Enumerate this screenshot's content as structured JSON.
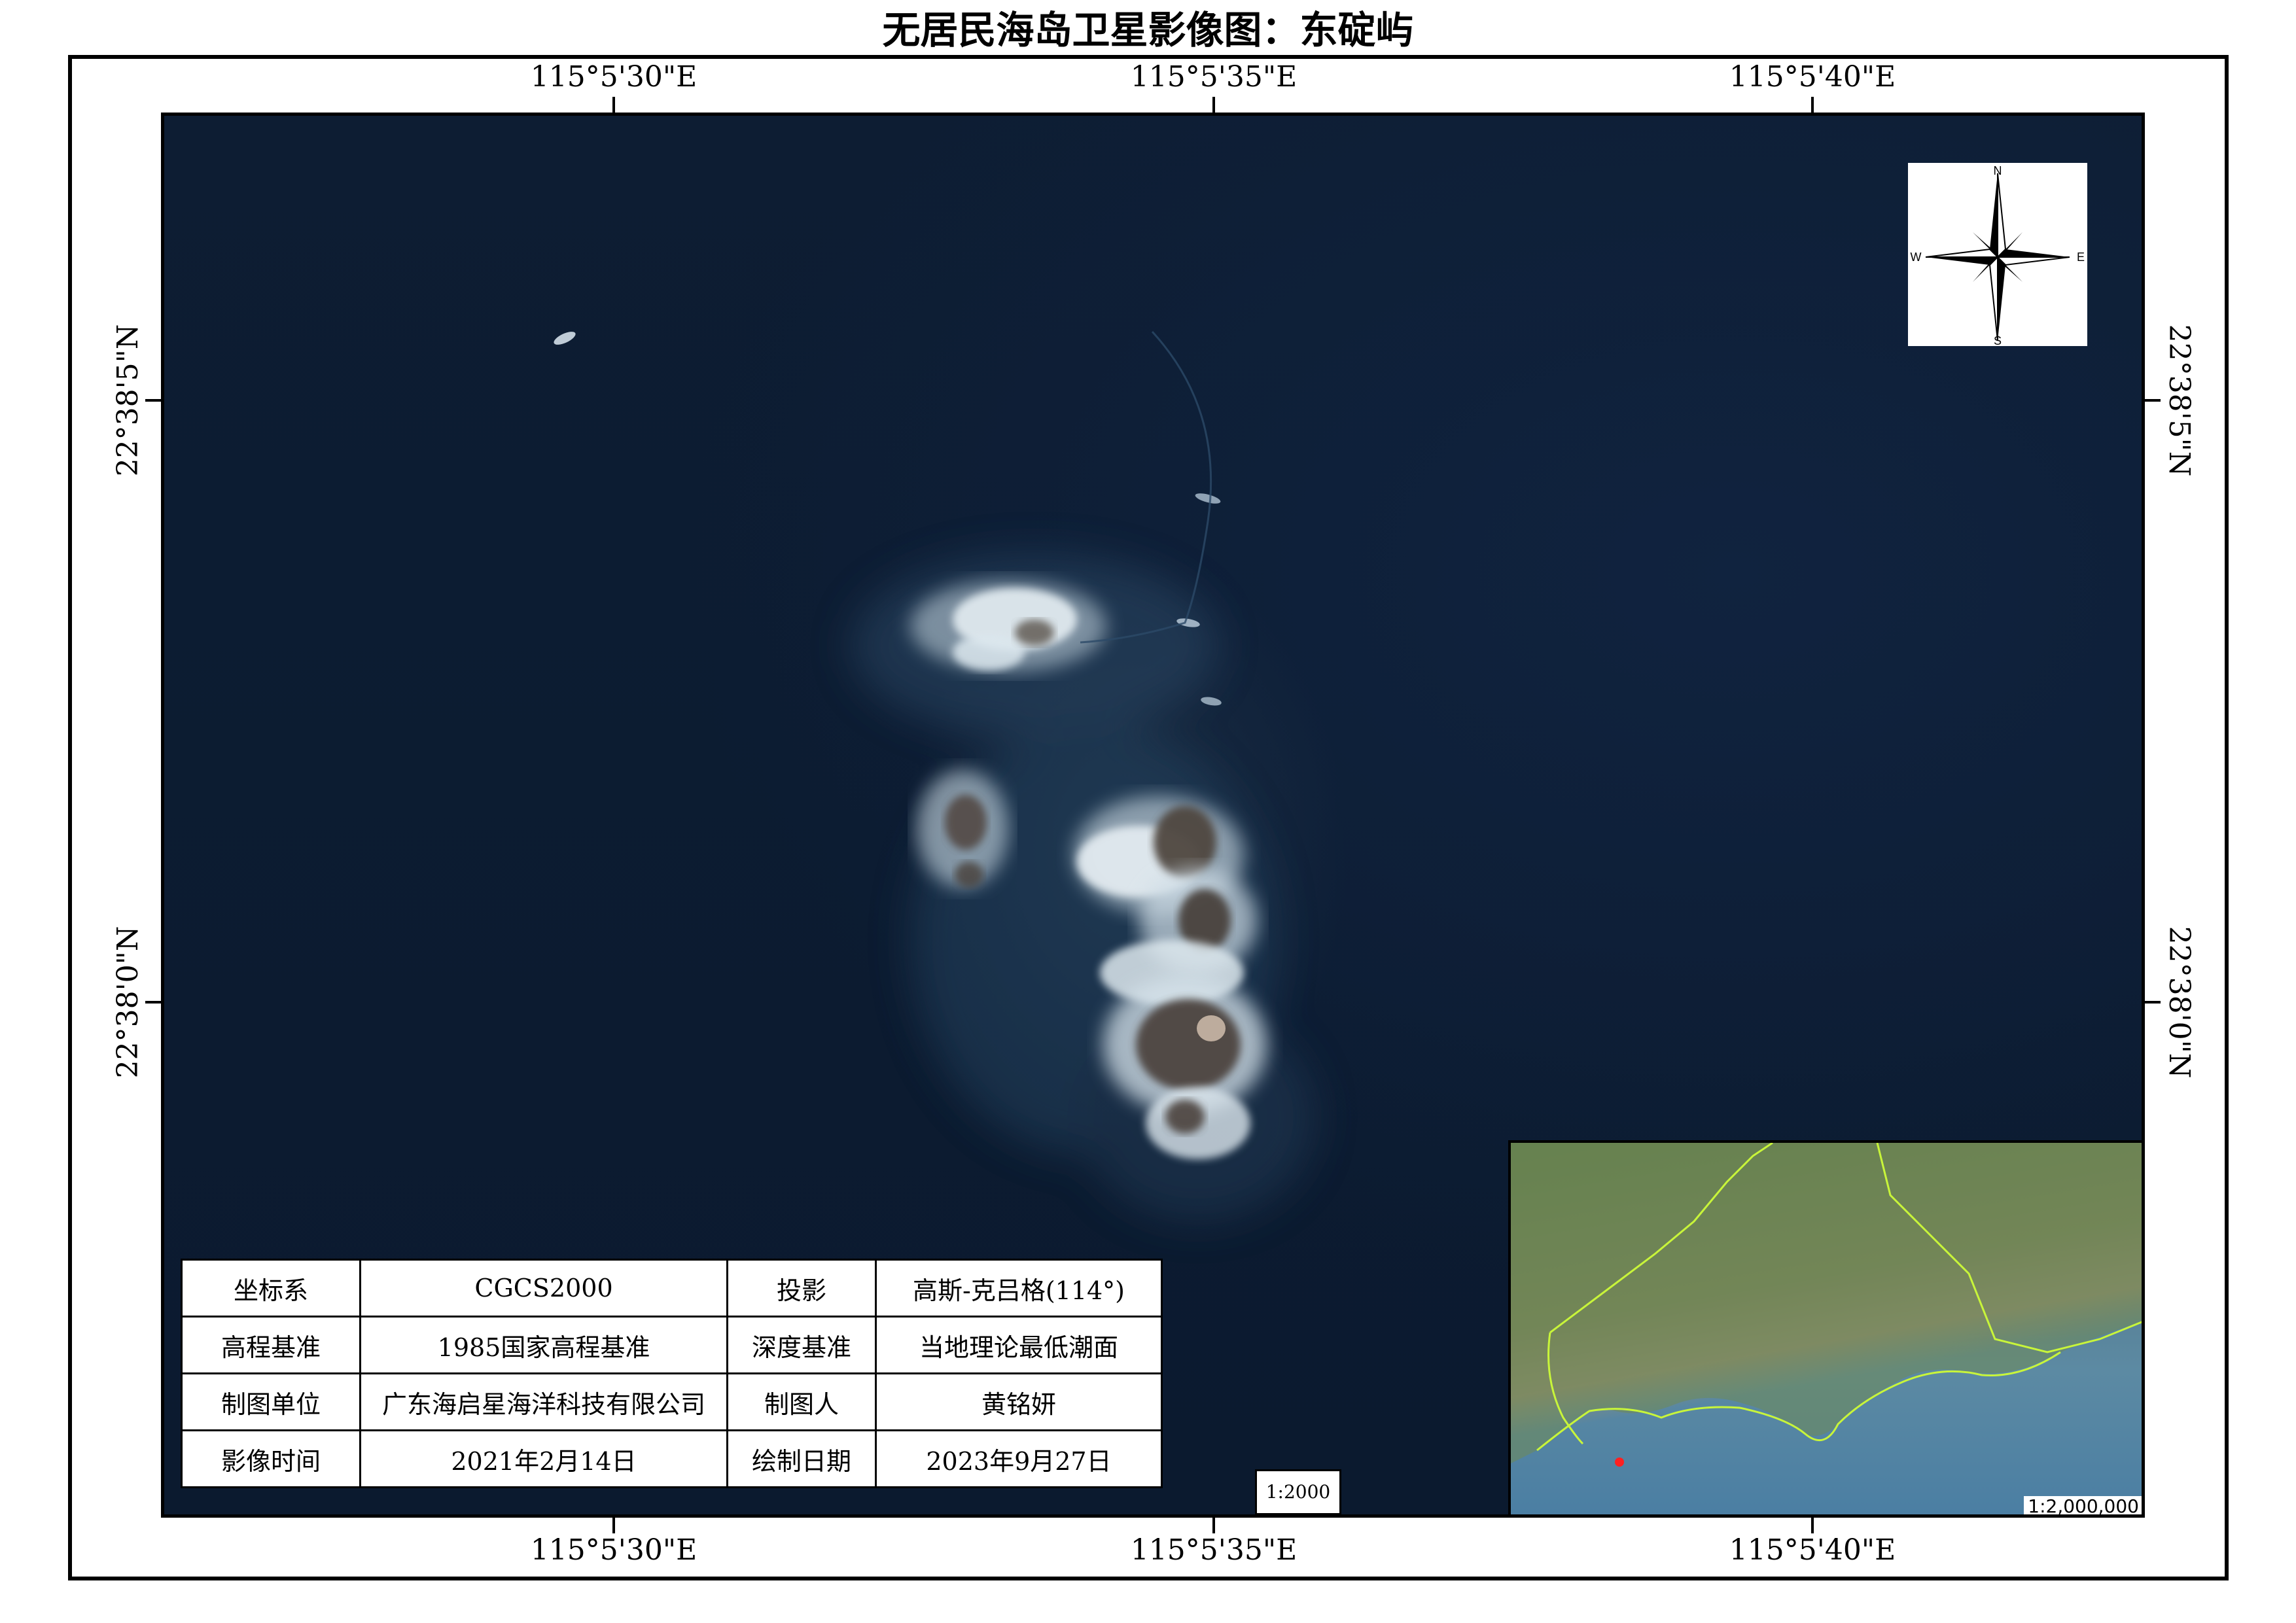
{
  "title": "无居民海岛卫星影像图：东碇屿",
  "coords": {
    "top": [
      "115°5'30\"E",
      "115°5'35\"E",
      "115°5'40\"E"
    ],
    "bottom": [
      "115°5'30\"E",
      "115°5'35\"E",
      "115°5'40\"E"
    ],
    "left": [
      "22°38'5\"N",
      "22°38'0\"N"
    ],
    "right": [
      "22°38'5\"N",
      "22°38'0\"N"
    ]
  },
  "compass": {
    "n": "N",
    "s": "S",
    "e": "E",
    "w": "W"
  },
  "info_table": {
    "rows": [
      {
        "label1": "坐标系",
        "value1": "CGCS2000",
        "label2": "投影",
        "value2": "高斯-克吕格(114°)"
      },
      {
        "label1": "高程基准",
        "value1": "1985国家高程基准",
        "label2": "深度基准",
        "value2": "当地理论最低潮面"
      },
      {
        "label1": "制图单位",
        "value1": "广东海启星海洋科技有限公司",
        "label2": "制图人",
        "value2": "黄铭妍"
      },
      {
        "label1": "影像时间",
        "value1": "2021年2月14日",
        "label2": "绘制日期",
        "value2": "2023年9月27日"
      }
    ]
  },
  "scale": "1:2000",
  "inset": {
    "scale": "1:2,000,000",
    "boundary_color": "#c8f53a",
    "marker_color": "#ff2020"
  },
  "colors": {
    "sea": "#0c1b31",
    "surf": "#dfe9ef",
    "rock": "#4b4440"
  }
}
